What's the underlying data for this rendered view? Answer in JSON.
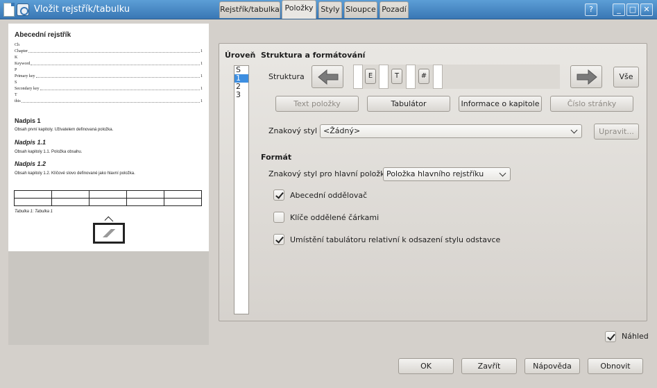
{
  "window": {
    "title": "Vložit rejstřík/tabulku",
    "controls": {
      "help": "?",
      "minimize": "_",
      "maximize": "□",
      "close": "✕"
    }
  },
  "preview": {
    "index_title": "Abecední rejstřík",
    "entries": [
      {
        "label": "Ch",
        "page": ""
      },
      {
        "label": "Chapter",
        "page": "1"
      },
      {
        "label": "K",
        "page": ""
      },
      {
        "label": "Keyword",
        "page": "1"
      },
      {
        "label": "P",
        "page": ""
      },
      {
        "label": "Primary key",
        "page": "1"
      },
      {
        "label": "S",
        "page": ""
      },
      {
        "label": "Secondary key",
        "page": "1"
      },
      {
        "label": "T",
        "page": ""
      },
      {
        "label": "this",
        "page": "1"
      }
    ],
    "heading1": "Nadpis 1",
    "heading1_body": "Obsah první kapitoly. Uživatelem definovaná položka.",
    "heading11": "Nadpis 1.1",
    "heading11_body": "Obsah kapitoly 1.1. Položka obsahu.",
    "heading12": "Nadpis 1.2",
    "heading12_body": "Obsah kapitoly 1.2. Klíčové slovo definované jako hlavní položka.",
    "table_caption": "Tabulka 1: Tabulka 1"
  },
  "tabs": [
    {
      "label": "Rejstřík/tabulka",
      "active": false
    },
    {
      "label": "Položky",
      "active": true
    },
    {
      "label": "Styly",
      "active": false
    },
    {
      "label": "Sloupce",
      "active": false
    },
    {
      "label": "Pozadí",
      "active": false
    }
  ],
  "level": {
    "label": "Úroveň",
    "items": [
      "S",
      "1",
      "2",
      "3"
    ],
    "selected": "1"
  },
  "structure": {
    "section_title": "Struktura a formátování",
    "label": "Struktura",
    "tokens": [
      "E",
      "T",
      "#"
    ],
    "all_button": "Vše",
    "insert_buttons": {
      "entry_text": "Text položky",
      "tab_stop": "Tabulátor",
      "chapter_info": "Informace o kapitole",
      "page_number": "Číslo stránky"
    },
    "char_style_label": "Znakový styl",
    "char_style_value": "<Žádný>",
    "edit_button": "Upravit..."
  },
  "format": {
    "section_title": "Formát",
    "main_entry_style_label": "Znakový styl pro hlavní položky",
    "main_entry_style_value": "Položka hlavního rejstříku",
    "alpha_delimiter": {
      "label": "Abecední oddělovač",
      "checked": true
    },
    "keys_separate": {
      "label": "Klíče oddělené čárkami",
      "checked": false
    },
    "tab_relative": {
      "label": "Umístění tabulátoru relativní k odsazení stylu odstavce",
      "checked": true
    }
  },
  "footer": {
    "preview": {
      "label": "Náhled",
      "checked": true
    },
    "ok": "OK",
    "close": "Zavřít",
    "help": "Nápověda",
    "reset": "Obnovit"
  }
}
